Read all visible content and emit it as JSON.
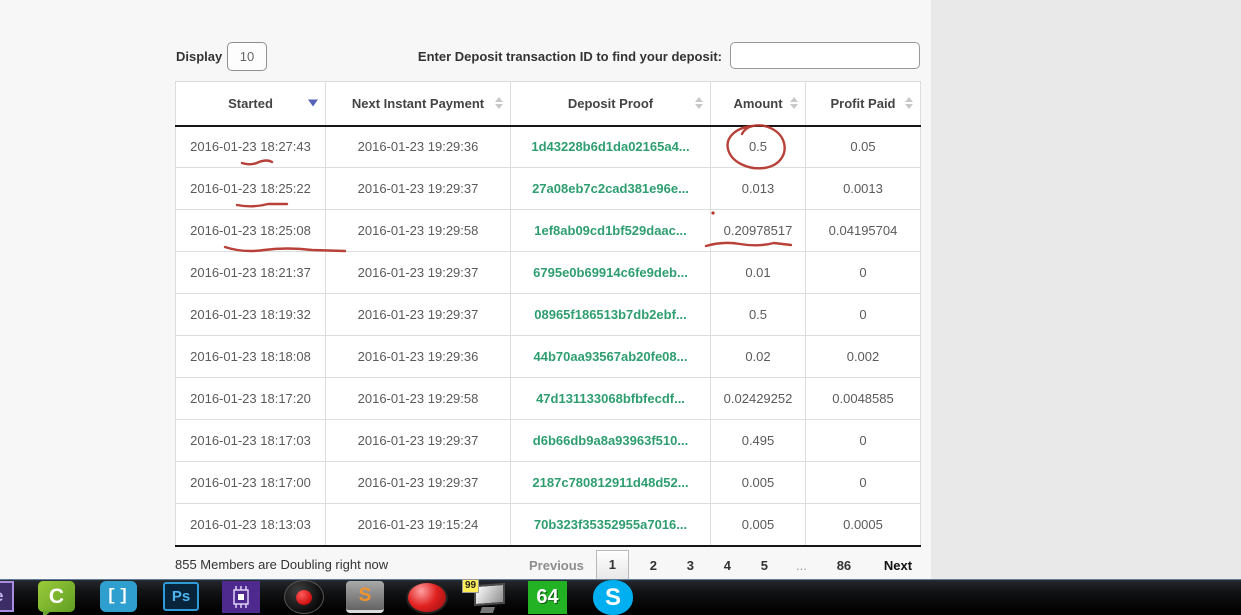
{
  "controls": {
    "display_label": "Display",
    "display_value": "10",
    "search_label": "Enter Deposit transaction ID to find your deposit:",
    "search_value": ""
  },
  "table": {
    "columns": [
      {
        "label": "Started"
      },
      {
        "label": "Next Instant Payment"
      },
      {
        "label": "Deposit Proof"
      },
      {
        "label": "Amount"
      },
      {
        "label": "Profit Paid"
      }
    ],
    "sorted_column": "Started",
    "sort_direction": "descending",
    "rows": [
      [
        "2016-01-23 18:27:43",
        "2016-01-23 19:29:36",
        "1d43228b6d1da02165a4...",
        "0.5",
        "0.05"
      ],
      [
        "2016-01-23 18:25:22",
        "2016-01-23 19:29:37",
        "27a08eb7c2cad381e96e...",
        "0.013",
        "0.0013"
      ],
      [
        "2016-01-23 18:25:08",
        "2016-01-23 19:29:58",
        "1ef8ab09cd1bf529daac...",
        "0.20978517",
        "0.04195704"
      ],
      [
        "2016-01-23 18:21:37",
        "2016-01-23 19:29:37",
        "6795e0b69914c6fe9deb...",
        "0.01",
        "0"
      ],
      [
        "2016-01-23 18:19:32",
        "2016-01-23 19:29:37",
        "08965f186513b7db2ebf...",
        "0.5",
        "0"
      ],
      [
        "2016-01-23 18:18:08",
        "2016-01-23 19:29:36",
        "44b70aa93567ab20fe08...",
        "0.02",
        "0.002"
      ],
      [
        "2016-01-23 18:17:20",
        "2016-01-23 19:29:58",
        "47d131133068bfbfecdf...",
        "0.02429252",
        "0.0048585"
      ],
      [
        "2016-01-23 18:17:03",
        "2016-01-23 19:29:37",
        "d6b66db9a8a93963f510...",
        "0.495",
        "0"
      ],
      [
        "2016-01-23 18:17:00",
        "2016-01-23 19:29:37",
        "2187c780812911d48d52...",
        "0.005",
        "0"
      ],
      [
        "2016-01-23 18:13:03",
        "2016-01-23 19:15:24",
        "70b323f35352955a7016...",
        "0.005",
        "0.0005"
      ]
    ]
  },
  "footer": {
    "status": "855 Members are Doubling right now",
    "pagination": {
      "previous": "Previous",
      "pages": [
        "1",
        "2",
        "3",
        "4",
        "5"
      ],
      "ellipsis": "...",
      "last_page": "86",
      "next": "Next",
      "active_page": "1"
    }
  },
  "annotations": {
    "tool": "red-pen",
    "color": "#b4382e",
    "items": [
      "circle around Amount 0.5 in first row",
      "underline under 18:27:43",
      "underline under 18:25:22",
      "long underline under 18:25:08",
      "underline under 0.20978517",
      "dot above 0.20978517"
    ]
  },
  "taskbar": {
    "icons": [
      {
        "name": "adobe-partial",
        "label": "e"
      },
      {
        "name": "camtasia",
        "label": "C"
      },
      {
        "name": "brackets",
        "label": "[]"
      },
      {
        "name": "photoshop",
        "label": "Ps"
      },
      {
        "name": "chip-utility",
        "label": ""
      },
      {
        "name": "screen-recorder-black",
        "label": ""
      },
      {
        "name": "sublime-text",
        "label": "S"
      },
      {
        "name": "record-button-red",
        "label": ""
      },
      {
        "name": "remote-monitor",
        "badge": "99"
      },
      {
        "name": "sixty-four-bit",
        "label": "64"
      },
      {
        "name": "skype",
        "label": "S"
      }
    ]
  },
  "colors": {
    "link_green": "#2e9e70",
    "annotation_red": "#b4382e",
    "sort_arrow_blue": "#5663b8",
    "table_border": "#dddddd",
    "header_rule": "#161616",
    "taskbar_bg": "#000000"
  }
}
